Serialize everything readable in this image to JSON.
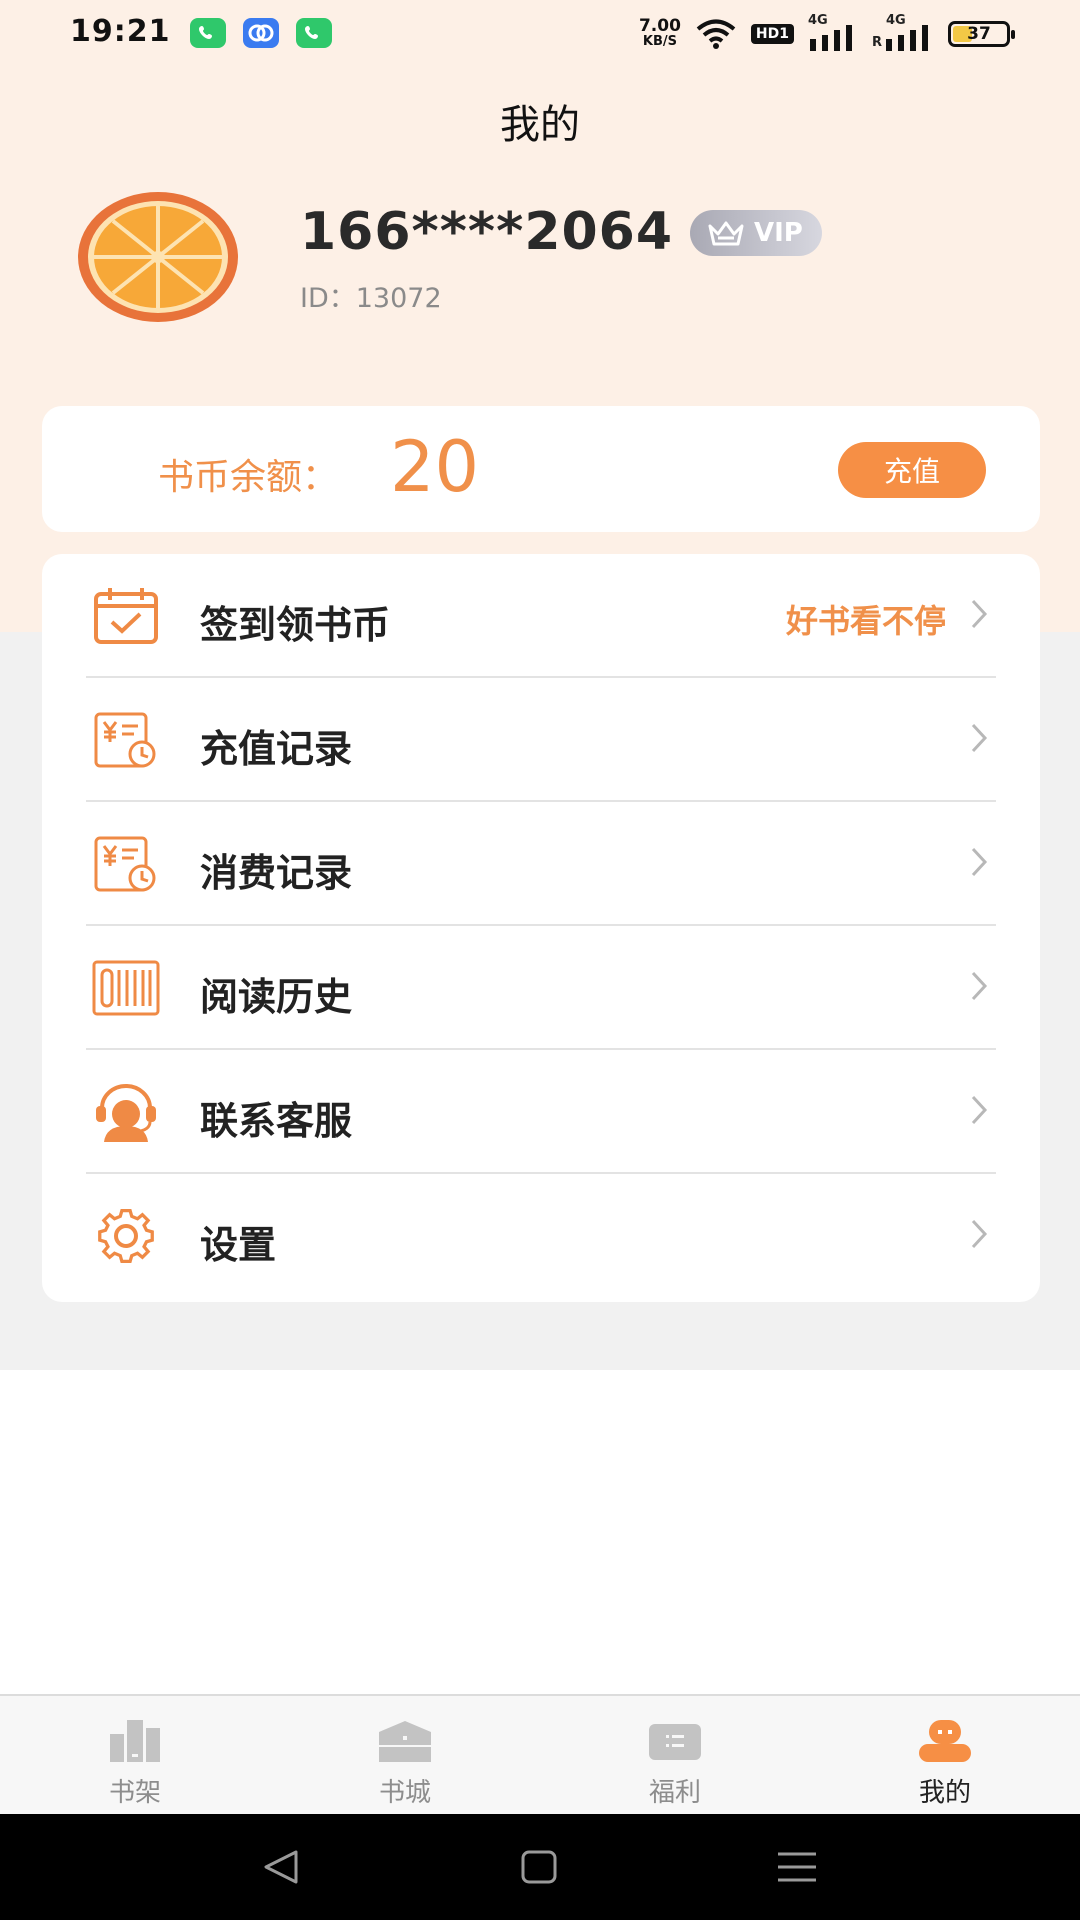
{
  "status_bar": {
    "time": "19:21",
    "net_speed_value": "7.00",
    "net_speed_unit": "KB/S",
    "hd_label": "HD1",
    "signal1_label": "4G",
    "signal2_label": "4G",
    "roaming_label": "R",
    "battery_level": "37",
    "notifications": [
      "phone-icon",
      "dual-circle-app-icon",
      "phone-icon"
    ]
  },
  "header": {
    "title": "我的"
  },
  "profile": {
    "username": "166****2064",
    "vip_label": "VIP",
    "user_id": "ID：13072"
  },
  "balance": {
    "label": "书币余额：",
    "value": "20",
    "recharge_label": "充值"
  },
  "menu": [
    {
      "label": "签到领书币",
      "hint": "好书看不停",
      "icon": "calendar-check-icon"
    },
    {
      "label": "充值记录",
      "icon": "recharge-record-icon"
    },
    {
      "label": "消费记录",
      "icon": "spend-record-icon"
    },
    {
      "label": "阅读历史",
      "icon": "reading-history-icon"
    },
    {
      "label": "联系客服",
      "icon": "customer-service-icon"
    },
    {
      "label": "设置",
      "icon": "gear-icon"
    }
  ],
  "bottom_nav": [
    {
      "label": "书架",
      "icon": "bookshelf-icon",
      "active": false
    },
    {
      "label": "书城",
      "icon": "bookstore-icon",
      "active": false
    },
    {
      "label": "福利",
      "icon": "welfare-icon",
      "active": false
    },
    {
      "label": "我的",
      "icon": "profile-icon",
      "active": true
    }
  ],
  "colors": {
    "accent": "#f68f45",
    "header_bg": "#fdf0e6",
    "page_bg": "#f1f1f1",
    "battery": "#f3c846"
  }
}
